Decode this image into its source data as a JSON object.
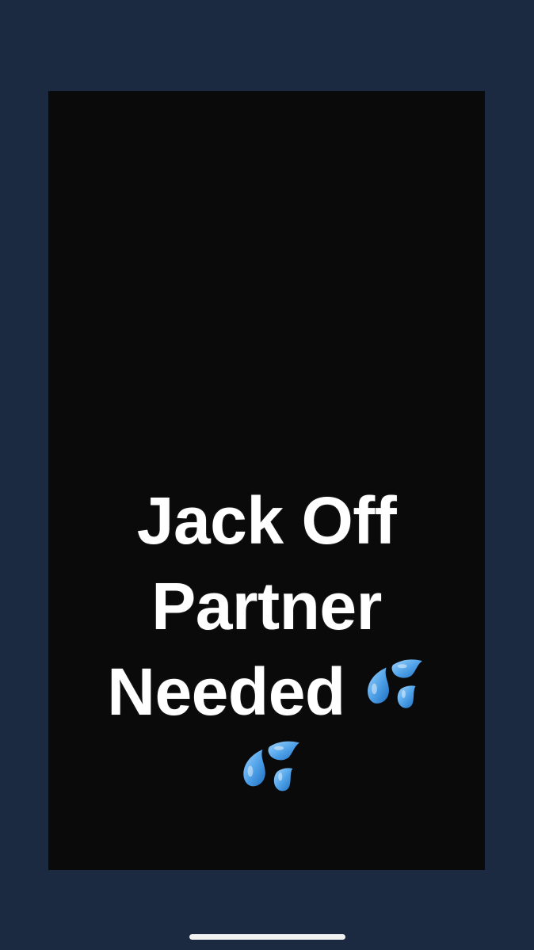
{
  "story": {
    "caption_lines": [
      "Jack Off",
      "Partner",
      "Needed"
    ],
    "emoji": "sweat-droplets-icon"
  },
  "colors": {
    "page_background": "#1b2a40",
    "story_background": "#0a0a0b",
    "caption_text": "#ffffff",
    "droplet_blue": "#5aa9ea"
  }
}
